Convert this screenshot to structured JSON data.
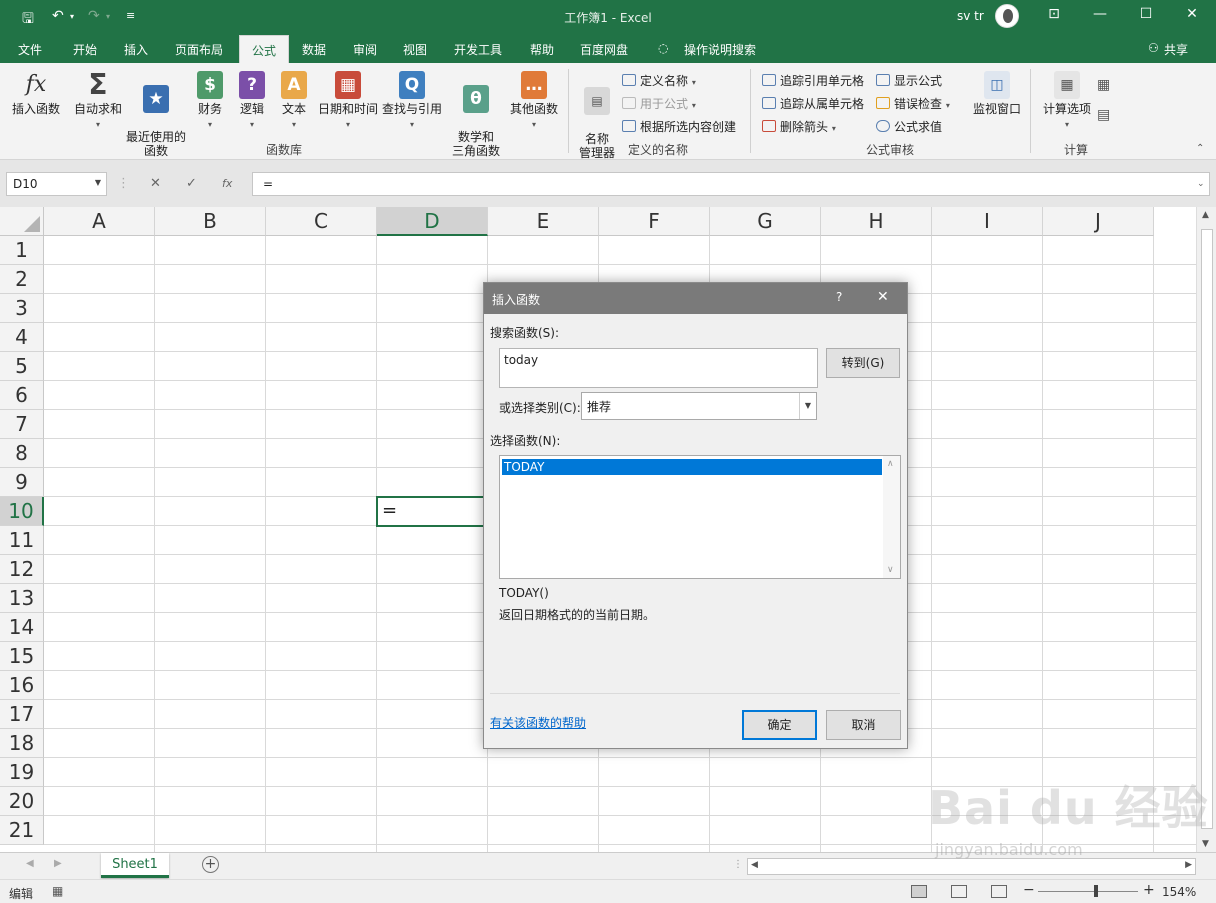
{
  "titlebar": {
    "title": "工作簿1  -  Excel",
    "user": "sv tr"
  },
  "tabs": [
    "文件",
    "开始",
    "插入",
    "页面布局",
    "公式",
    "数据",
    "审阅",
    "视图",
    "开发工具",
    "帮助",
    "百度网盘",
    "操作说明搜索"
  ],
  "share_label": "共享",
  "ribbon": {
    "function_library": {
      "buttons": [
        {
          "label": "插入函数",
          "icon": "fx"
        },
        {
          "label": "自动求和",
          "icon": "Σ"
        },
        {
          "label": "最近使用的\n函数",
          "icon": "★"
        },
        {
          "label": "财务",
          "icon": "$"
        },
        {
          "label": "逻辑",
          "icon": "?"
        },
        {
          "label": "文本",
          "icon": "A"
        },
        {
          "label": "日期和时间",
          "icon": "▦"
        },
        {
          "label": "查找与引用",
          "icon": "Q"
        },
        {
          "label": "数学和\n三角函数",
          "icon": "θ"
        },
        {
          "label": "其他函数",
          "icon": "…"
        }
      ],
      "group_label": "函数库"
    },
    "defined_names": {
      "name_manager": "名称\n管理器",
      "define_name": "定义名称",
      "use_in_formula": "用于公式",
      "create_from_selection": "根据所选内容创建",
      "group_label": "定义的名称"
    },
    "formula_auditing": {
      "trace_precedents": "追踪引用单元格",
      "trace_dependents": "追踪从属单元格",
      "remove_arrows": "删除箭头",
      "show_formulas": "显示公式",
      "error_checking": "错误检查",
      "evaluate_formula": "公式求值",
      "watch_window": "监视窗口",
      "group_label": "公式审核"
    },
    "calculation": {
      "options": "计算选项",
      "group_label": "计算"
    }
  },
  "formula_bar": {
    "name_box": "D10",
    "cancel": "✕",
    "enter": "✓",
    "fx": "fx",
    "formula": "="
  },
  "columns": [
    "A",
    "B",
    "C",
    "D",
    "E",
    "F",
    "G",
    "H",
    "I",
    "J"
  ],
  "rows": [
    "1",
    "2",
    "3",
    "4",
    "5",
    "6",
    "7",
    "8",
    "9",
    "10",
    "11",
    "12",
    "13",
    "14",
    "15",
    "16",
    "17",
    "18",
    "19",
    "20",
    "21"
  ],
  "active_cell": {
    "ref": "D10",
    "value": "="
  },
  "sheet_tab": "Sheet1",
  "status": {
    "mode": "编辑",
    "zoom": "154%"
  },
  "dialog": {
    "title": "插入函数",
    "help": "?",
    "close": "✕",
    "search_label": "搜索函数(S):",
    "search_value": "today",
    "go_button": "转到(G)",
    "category_label": "或选择类别(C):",
    "category_value": "推荐",
    "select_label": "选择函数(N):",
    "functions": [
      "TODAY"
    ],
    "signature": "TODAY()",
    "description": "返回日期格式的的当前日期。",
    "help_link": "有关该函数的帮助",
    "ok": "确定",
    "cancel": "取消"
  },
  "watermark": {
    "main": "Bai du 经验",
    "sub": "jingyan.baidu.com"
  },
  "colors": {
    "excel_green": "#217346",
    "selection_blue": "#0078d7"
  }
}
